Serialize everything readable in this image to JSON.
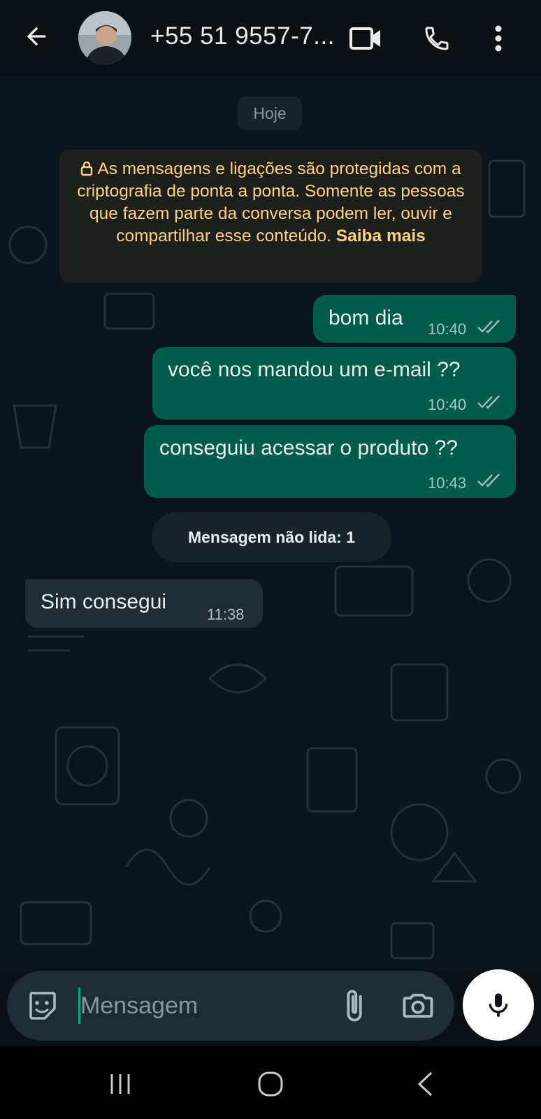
{
  "header": {
    "contact_name": "+55 51 9557-7...",
    "back_icon": "arrow-left-icon",
    "video_icon": "video-call-icon",
    "call_icon": "phone-icon",
    "menu_icon": "more-vert-icon"
  },
  "chat": {
    "date_label": "Hoje",
    "encryption_notice": "As mensagens e ligações são protegidas com a criptografia de ponta a ponta. Somente as pessoas que fazem parte da conversa podem ler, ouvir e compartilhar esse conteúdo.",
    "learn_more": "Saiba mais",
    "messages": [
      {
        "direction": "out",
        "text": "bom dia",
        "time": "10:40",
        "status": "read"
      },
      {
        "direction": "out",
        "text": "você nos mandou um e-mail ??",
        "time": "10:40",
        "status": "read"
      },
      {
        "direction": "out",
        "text": "conseguiu acessar o produto ??",
        "time": "10:43",
        "status": "read"
      },
      {
        "direction": "in",
        "text": "Sim consegui",
        "time": "11:38"
      }
    ],
    "unread_label": "Mensagem não lida: 1"
  },
  "composer": {
    "placeholder": "Mensagem",
    "emoji_icon": "sticker-emoji-icon",
    "attach_icon": "paperclip-icon",
    "camera_icon": "camera-icon",
    "mic_icon": "microphone-icon"
  },
  "colors": {
    "outgoing_bubble": "#005c4b",
    "incoming_bubble": "#202c33",
    "chat_background": "#0b141a",
    "notice_text": "#ffd279",
    "accent": "#00a884"
  }
}
